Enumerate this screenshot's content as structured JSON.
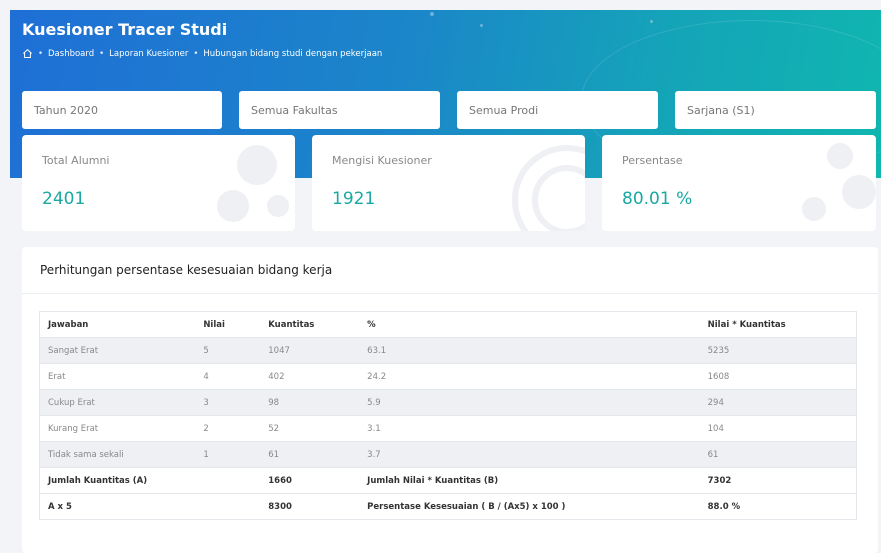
{
  "header": {
    "title": "Kuesioner Tracer Studi",
    "breadcrumb": [
      "Dashboard",
      "Laporan Kuesioner",
      "Hubungan bidang studi dengan pekerjaan"
    ]
  },
  "filters": {
    "tahun": "Tahun 2020",
    "fakultas": "Semua Fakultas",
    "prodi": "Semua Prodi",
    "jenjang": "Sarjana (S1)"
  },
  "stats": {
    "total_alumni": {
      "label": "Total Alumni",
      "value": "2401"
    },
    "mengisi": {
      "label": "Mengisi Kuesioner",
      "value": "1921"
    },
    "persentase": {
      "label": "Persentase",
      "value": "80.01 %"
    }
  },
  "panel": {
    "title": "Perhitungan persentase kesesuaian bidang kerja"
  },
  "table": {
    "headers": [
      "Jawaban",
      "Nilai",
      "Kuantitas",
      "%",
      "Nilai * Kuantitas"
    ],
    "rows": [
      [
        "Sangat Erat",
        "5",
        "1047",
        "63.1",
        "5235"
      ],
      [
        "Erat",
        "4",
        "402",
        "24.2",
        "1608"
      ],
      [
        "Cukup Erat",
        "3",
        "98",
        "5.9",
        "294"
      ],
      [
        "Kurang Erat",
        "2",
        "52",
        "3.1",
        "104"
      ],
      [
        "Tidak sama sekali",
        "1",
        "61",
        "3.7",
        "61"
      ]
    ],
    "summary": [
      [
        "Jumlah Kuantitas (A)",
        "",
        "1660",
        "Jumlah Nilai * Kuantitas (B)",
        "7302"
      ],
      [
        "A x 5",
        "",
        "8300",
        "Persentase Kesesuaian ( B / (Ax5) x 100 )",
        "88.0 %"
      ]
    ]
  },
  "colors": {
    "accent": "#19a9a2",
    "header_start": "#1f6fd6",
    "header_end": "#10b6b0"
  },
  "icons": {
    "home": "home-icon"
  }
}
